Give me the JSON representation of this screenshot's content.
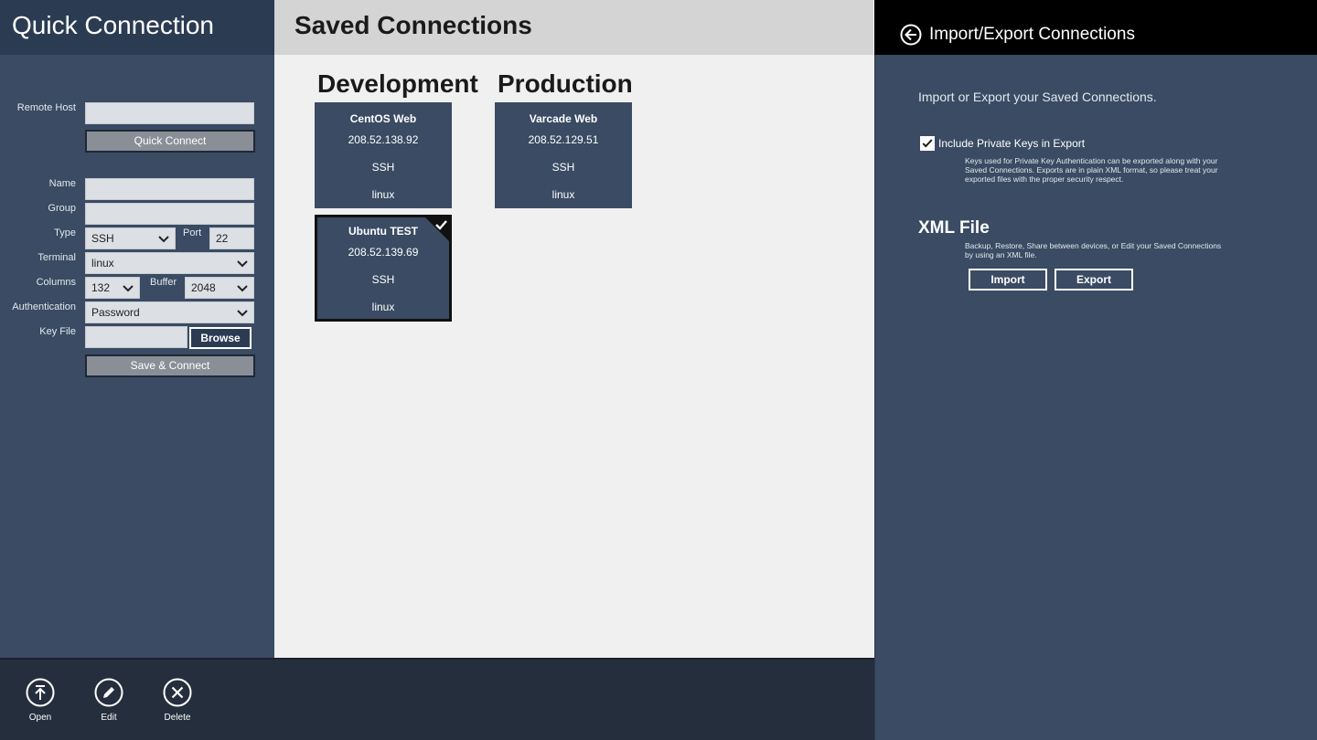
{
  "quick_connection": {
    "title": "Quick Connection",
    "remote_host_label": "Remote Host",
    "remote_host_value": "",
    "quick_connect_label": "Quick Connect",
    "name_label": "Name",
    "name_value": "",
    "group_label": "Group",
    "group_value": "",
    "type_label": "Type",
    "type_value": "SSH",
    "port_label": "Port",
    "port_value": "22",
    "terminal_label": "Terminal",
    "terminal_value": "linux",
    "columns_label": "Columns",
    "columns_value": "132",
    "buffer_label": "Buffer",
    "buffer_value": "2048",
    "authentication_label": "Authentication",
    "authentication_value": "Password",
    "key_file_label": "Key File",
    "key_file_value": "",
    "browse_label": "Browse",
    "save_connect_label": "Save & Connect"
  },
  "saved_connections": {
    "title": "Saved Connections",
    "groups": [
      {
        "name": "Development",
        "connections": [
          {
            "name": "CentOS Web",
            "ip": "208.52.138.92",
            "type": "SSH",
            "terminal": "linux",
            "selected": false
          },
          {
            "name": "Ubuntu TEST",
            "ip": "208.52.139.69",
            "type": "SSH",
            "terminal": "linux",
            "selected": true
          }
        ]
      },
      {
        "name": "Production",
        "connections": [
          {
            "name": "Varcade Web",
            "ip": "208.52.129.51",
            "type": "SSH",
            "terminal": "linux",
            "selected": false
          }
        ]
      }
    ]
  },
  "app_bar": {
    "open_label": "Open",
    "edit_label": "Edit",
    "delete_label": "Delete"
  },
  "flyout": {
    "title": "Import/Export Connections",
    "intro": "Import or Export your Saved Connections.",
    "include_private_keys_label": "Include Private Keys in Export",
    "include_private_keys_checked": true,
    "private_keys_description": "Keys used for Private Key Authentication can be exported along with your Saved Connections.  Exports are in plain XML format, so please treat your exported files with the proper security respect.",
    "xml_heading": "XML File",
    "xml_description": "Backup, Restore, Share between devices, or Edit your Saved Connections by using an XML file.",
    "import_label": "Import",
    "export_label": "Export"
  },
  "colors": {
    "panel": "#3a4b63",
    "panel_dark": "#2b3b52",
    "app_bar": "#252e3d",
    "saved_bg": "#f0f0f0",
    "flyout_header": "#000000"
  },
  "icons": {
    "back": "back-arrow-icon",
    "open": "open-icon",
    "edit": "edit-icon",
    "delete": "delete-icon",
    "chevron": "chevron-down-icon",
    "check": "checkmark-icon"
  }
}
